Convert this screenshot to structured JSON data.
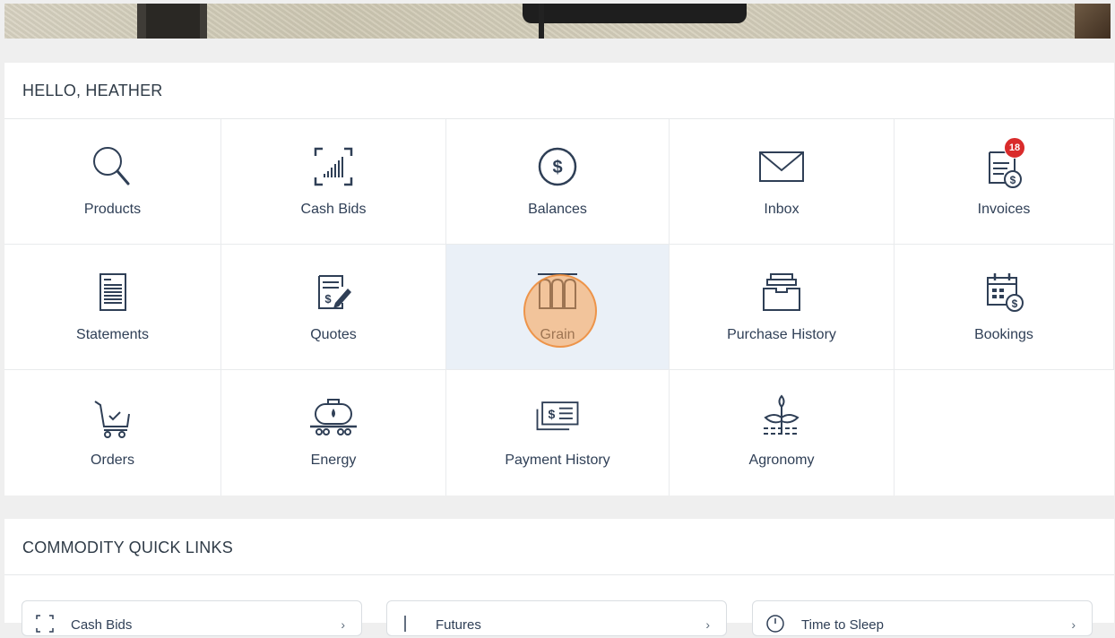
{
  "greeting": {
    "title": "HELLO, HEATHER"
  },
  "tiles": [
    {
      "label": "Products",
      "icon": "search-icon"
    },
    {
      "label": "Cash Bids",
      "icon": "cash-bids-chart-icon"
    },
    {
      "label": "Balances",
      "icon": "dollar-circle-icon"
    },
    {
      "label": "Inbox",
      "icon": "envelope-icon"
    },
    {
      "label": "Invoices",
      "icon": "invoice-icon",
      "badge": "18"
    },
    {
      "label": "Statements",
      "icon": "statement-icon"
    },
    {
      "label": "Quotes",
      "icon": "quote-icon"
    },
    {
      "label": "Grain",
      "icon": "grain-bins-icon",
      "selected": true
    },
    {
      "label": "Purchase History",
      "icon": "file-box-icon"
    },
    {
      "label": "Bookings",
      "icon": "calendar-dollar-icon"
    },
    {
      "label": "Orders",
      "icon": "cart-icon"
    },
    {
      "label": "Energy",
      "icon": "tanker-icon"
    },
    {
      "label": "Payment History",
      "icon": "payment-bills-icon"
    },
    {
      "label": "Agronomy",
      "icon": "plant-icon"
    }
  ],
  "quick_links": {
    "title": "COMMODITY QUICK LINKS",
    "items": [
      {
        "label": "Cash Bids",
        "icon": "cash-bids-chart-icon"
      },
      {
        "label": "Futures",
        "icon": "futures-icon"
      },
      {
        "label": "Time to Sleep",
        "icon": "clock-icon"
      }
    ]
  },
  "colors": {
    "accent": "#2f3f56",
    "highlight": "#eaf0f7",
    "badge": "#d92b2b",
    "tap": "#f7a050"
  }
}
